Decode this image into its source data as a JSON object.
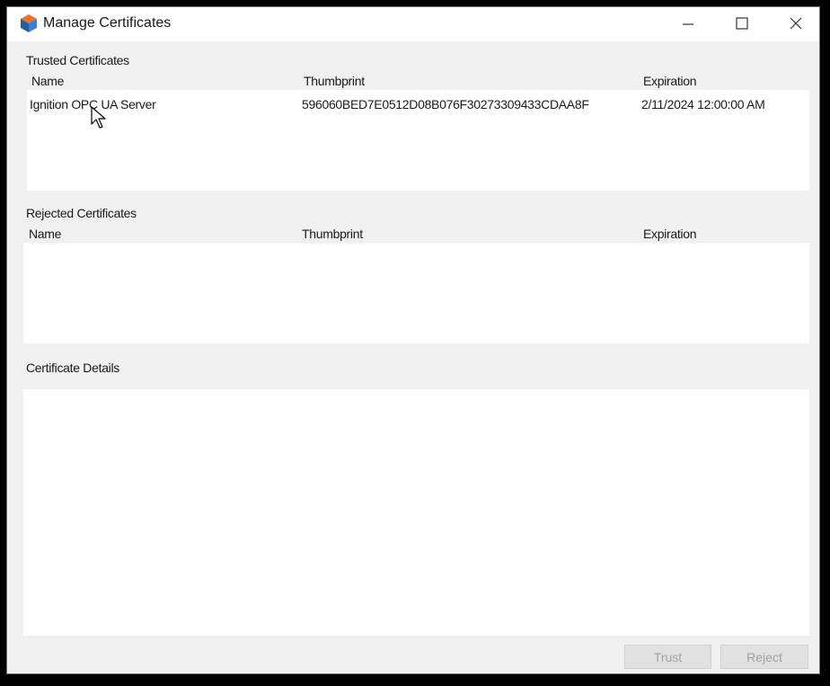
{
  "window": {
    "title": "Manage Certificates",
    "icon": "cube-app-icon",
    "controls": [
      "minimize-icon",
      "maximize-icon",
      "close-icon"
    ]
  },
  "trusted": {
    "label": "Trusted Certificates",
    "columns": {
      "name": "Name",
      "thumbprint": "Thumbprint",
      "expiration": "Expiration"
    },
    "rows": [
      {
        "name": "Ignition OPC UA Server",
        "thumbprint": "596060BED7E0512D08B076F30273309433CDAA8F",
        "expiration": "2/11/2024 12:00:00 AM"
      }
    ]
  },
  "rejected": {
    "label": "Rejected Certificates",
    "columns": {
      "name": "Name",
      "thumbprint": "Thumbprint",
      "expiration": "Expiration"
    },
    "rows": []
  },
  "details": {
    "label": "Certificate Details",
    "content": ""
  },
  "buttons": {
    "trust": "Trust",
    "reject": "Reject",
    "disabled": true
  },
  "colors": {
    "panel_bg": "#f0f0f0",
    "list_bg": "#ffffff",
    "disabled_text": "#a0a0a0"
  }
}
